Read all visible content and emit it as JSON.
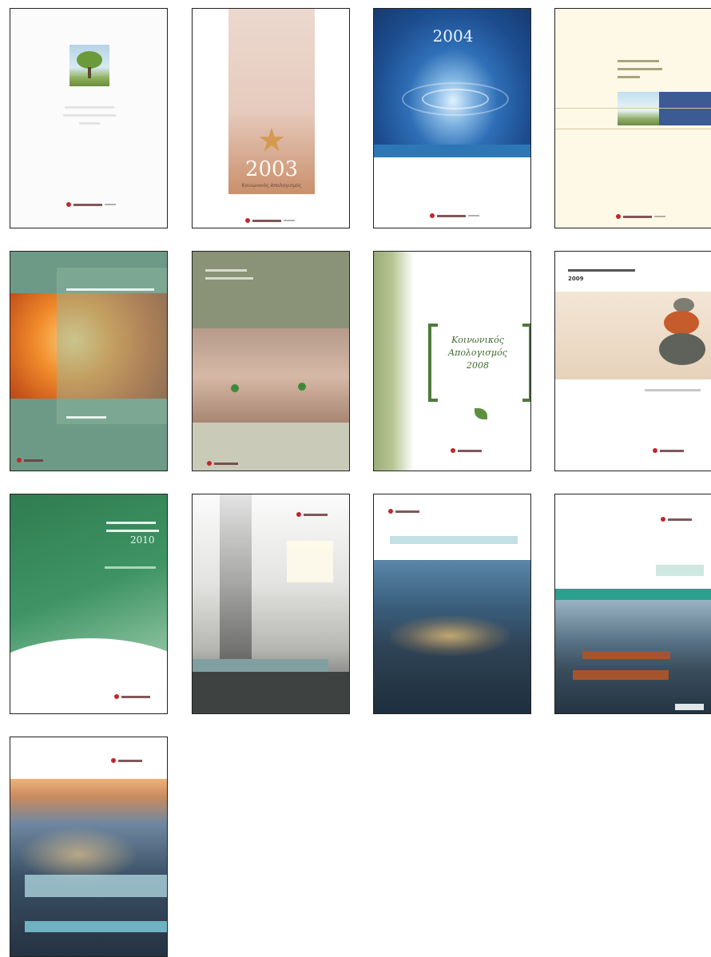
{
  "covers": [
    {
      "year": ""
    },
    {
      "year": "2003",
      "caption": "Κοινωνικός Απολογισμός"
    },
    {
      "year": "2004"
    },
    {
      "year": ""
    },
    {
      "year": ""
    },
    {
      "year": ""
    },
    {
      "year": "2008",
      "title_l1": "Κοινωνικός",
      "title_l2": "Απολογισμός"
    },
    {
      "year": "2009"
    },
    {
      "year": "2010"
    },
    {
      "year": ""
    },
    {
      "year": ""
    },
    {
      "year": ""
    },
    {
      "year": ""
    }
  ],
  "colors": {
    "logo_red": "#c0272d",
    "border": "#222222"
  }
}
